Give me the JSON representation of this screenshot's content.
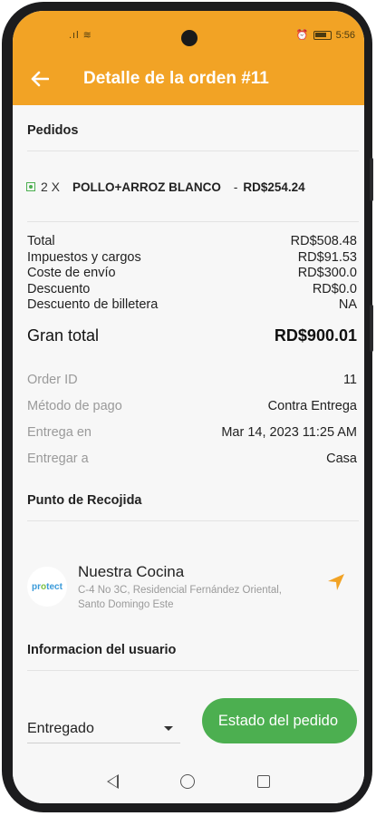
{
  "status_bar": {
    "time": "5:56"
  },
  "app_bar": {
    "title": "Detalle de la orden #11"
  },
  "orders": {
    "title": "Pedidos",
    "items": [
      {
        "quantity": "2 X",
        "name": "POLLO+ARROZ BLANCO",
        "separator": "-",
        "price": "RD$254.24"
      }
    ]
  },
  "summary": {
    "total_label": "Total",
    "total_value": "RD$508.48",
    "taxes_label": "Impuestos y cargos",
    "taxes_value": "RD$91.53",
    "shipping_label": "Coste de envío",
    "shipping_value": "RD$300.0",
    "discount_label": "Descuento",
    "discount_value": "RD$0.0",
    "wallet_label": "Descuento de billetera",
    "wallet_value": "NA"
  },
  "grand_total": {
    "label": "Gran total",
    "value": "RD$900.01"
  },
  "meta": {
    "order_id_label": "Order ID",
    "order_id_value": "11",
    "payment_label": "Método de pago",
    "payment_value": "Contra Entrega",
    "delivery_label": "Entrega en",
    "delivery_value": "Mar 14, 2023 11:25 AM",
    "deliver_to_label": "Entregar a",
    "deliver_to_value": "Casa"
  },
  "pickup": {
    "title": "Punto de Recojida",
    "logo_text_a": "pr",
    "logo_text_b": "o",
    "logo_text_c": "tect",
    "name": "Nuestra Cocina",
    "address": "C-4 No 3C, Residencial Fernández Oriental, Santo Domingo Este"
  },
  "user_info": {
    "title": "Informacion del usuario"
  },
  "status": {
    "selected": "Entregado",
    "button_label": "Estado del pedido"
  },
  "colors": {
    "accent": "#f2a325",
    "success": "#4caf50",
    "nav_icon": "#f2a325"
  }
}
